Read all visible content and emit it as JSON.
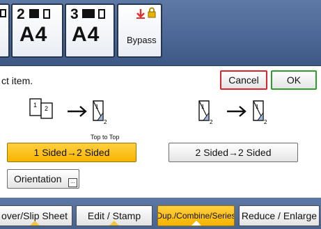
{
  "trays": [
    {
      "number": "2",
      "size": "A4"
    },
    {
      "number": "3",
      "size": "A4"
    },
    {
      "label": "Bypass"
    }
  ],
  "prompt": "ct item.",
  "dialog": {
    "cancel_label": "Cancel",
    "ok_label": "OK"
  },
  "options": {
    "one_to_two": {
      "label": "1 Sided→2 Sided",
      "orientation_caption": "Top to Top",
      "selected": true
    },
    "two_to_two": {
      "label": "2 Sided→2 Sided",
      "selected": false
    }
  },
  "orientation_button": {
    "label": "Orientation",
    "more": "..."
  },
  "tabs": [
    {
      "label": "over/Slip Sheet",
      "active": false
    },
    {
      "label": "Edit / Stamp",
      "active": false
    },
    {
      "label": "Dup./Combine/Series",
      "active": true
    },
    {
      "label": "Reduce / Enlarge",
      "active": false
    }
  ],
  "colors": {
    "accent": "#f7b400",
    "ok_border": "#2e9d2e",
    "cancel_border": "#d7262f",
    "bypass_icon": "#e23030"
  }
}
